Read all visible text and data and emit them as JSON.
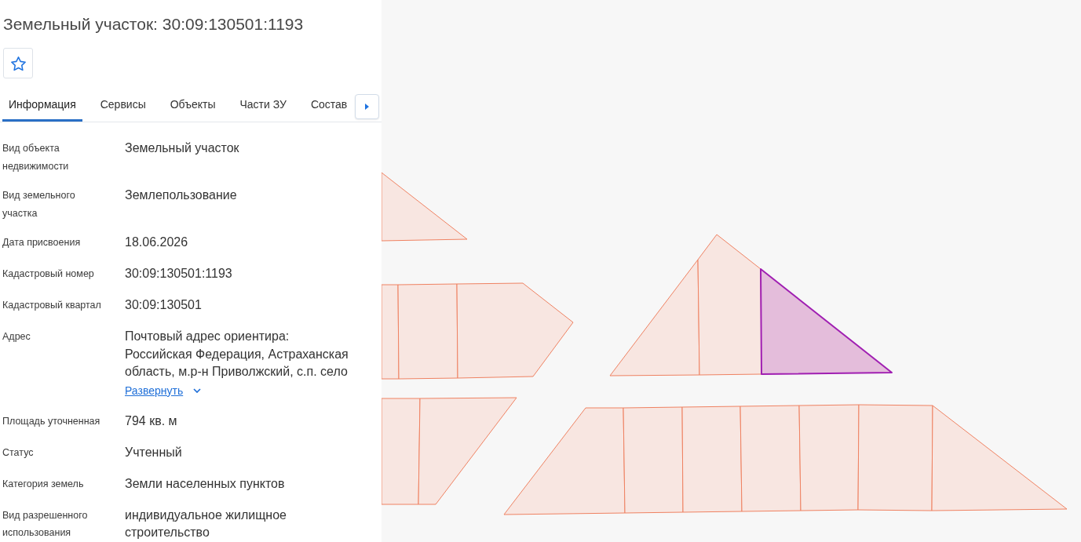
{
  "panel": {
    "title": "Земельный участок: 30:09:130501:1193"
  },
  "tabs": [
    {
      "label": "Информация",
      "selected": true
    },
    {
      "label": "Сервисы",
      "selected": false
    },
    {
      "label": "Объекты",
      "selected": false
    },
    {
      "label": "Части ЗУ",
      "selected": false
    },
    {
      "label": "Состав",
      "selected": false
    }
  ],
  "properties": [
    {
      "label": "Вид объекта недвижимости",
      "value": "Земельный участок"
    },
    {
      "label": "Вид земельного участка",
      "value": "Землепользование"
    },
    {
      "label": "Дата присвоения",
      "value": "18.06.2026"
    },
    {
      "label": "Кадастровый номер",
      "value": "30:09:130501:1193"
    },
    {
      "label": "Кадастровый квартал",
      "value": "30:09:130501"
    },
    {
      "label": "Адрес",
      "value": "Почтовый адрес ориентира: Российская Федерация, Астраханская область, м.р-н Приволжский, с.п. село",
      "expand_link": "Развернуть"
    },
    {
      "label": "Площадь уточненная",
      "value": "794 кв. м"
    },
    {
      "label": "Статус",
      "value": "Учтенный"
    },
    {
      "label": "Категория земель",
      "value": "Земли населенных пунктов"
    },
    {
      "label": "Вид разрешенного использования",
      "value": "индивидуальное жилищное строительство"
    }
  ],
  "map": {
    "parcels": [
      {
        "selected": false
      },
      {
        "selected": false
      },
      {
        "selected": false
      },
      {
        "selected": false
      },
      {
        "selected": false
      },
      {
        "selected": false
      },
      {
        "selected": false
      },
      {
        "selected": false
      },
      {
        "selected": true
      },
      {
        "selected": false
      },
      {
        "selected": false
      },
      {
        "selected": false
      },
      {
        "selected": false
      },
      {
        "selected": false
      },
      {
        "selected": false
      },
      {
        "selected": false
      }
    ]
  }
}
